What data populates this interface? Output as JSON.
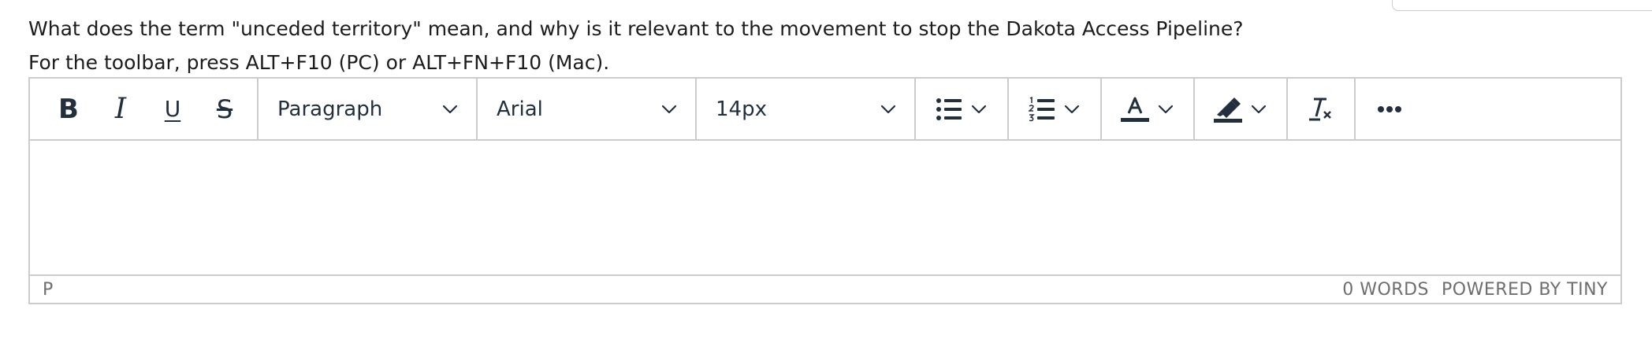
{
  "question": {
    "text": "What does the term \"unceded territory\" mean, and why is it relevant to the movement to stop the Dakota Access Pipeline?"
  },
  "editor_hint": "For the toolbar, press ALT+F10 (PC) or ALT+FN+F10 (Mac).",
  "toolbar": {
    "bold_label": "B",
    "italic_label": "I",
    "underline_label": "U",
    "strikethrough_label": "S",
    "block_format": "Paragraph",
    "font_family": "Arial",
    "font_size": "14px",
    "icons": {
      "bullet_list": "bullet-list-icon",
      "numbered_list": "numbered-list-icon",
      "text_color": "text-color-icon",
      "highlight": "highlighter-icon",
      "clear_format": "clear-formatting-icon",
      "more": "more-icon"
    }
  },
  "statusbar": {
    "path": "P",
    "word_count": "0 WORDS",
    "branding": "POWERED BY TINY"
  },
  "colors": {
    "border": "#cccccc",
    "icon": "#222f3e",
    "status_text": "#6e6e6e"
  }
}
